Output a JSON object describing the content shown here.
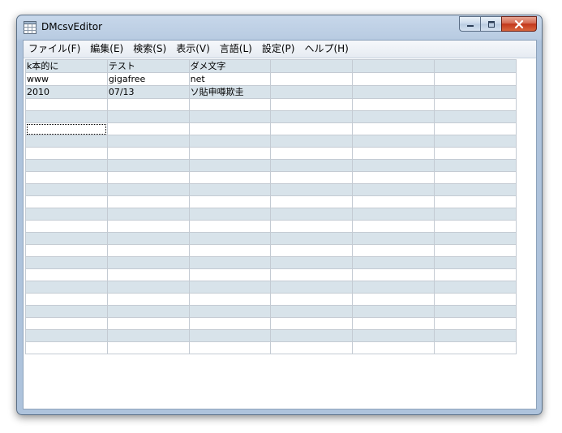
{
  "window": {
    "title": "DMcsvEditor"
  },
  "menu": [
    "ファイル(F)",
    "編集(E)",
    "検索(S)",
    "表示(V)",
    "言語(L)",
    "設定(P)",
    "ヘルプ(H)"
  ],
  "grid": {
    "columns": 6,
    "rows": [
      [
        "k本的に",
        "テスト",
        "ダメ文字",
        "",
        "",
        ""
      ],
      [
        "www",
        "gigafree",
        "net",
        "",
        "",
        ""
      ],
      [
        "2010",
        "07/13",
        "ソ貼申噂欺圭",
        "",
        "",
        ""
      ],
      [
        "",
        "",
        "",
        "",
        "",
        ""
      ],
      [
        "",
        "",
        "",
        "",
        "",
        ""
      ],
      [
        "",
        "",
        "",
        "",
        "",
        ""
      ],
      [
        "",
        "",
        "",
        "",
        "",
        ""
      ],
      [
        "",
        "",
        "",
        "",
        "",
        ""
      ],
      [
        "",
        "",
        "",
        "",
        "",
        ""
      ],
      [
        "",
        "",
        "",
        "",
        "",
        ""
      ],
      [
        "",
        "",
        "",
        "",
        "",
        ""
      ],
      [
        "",
        "",
        "",
        "",
        "",
        ""
      ],
      [
        "",
        "",
        "",
        "",
        "",
        ""
      ],
      [
        "",
        "",
        "",
        "",
        "",
        ""
      ],
      [
        "",
        "",
        "",
        "",
        "",
        ""
      ],
      [
        "",
        "",
        "",
        "",
        "",
        ""
      ],
      [
        "",
        "",
        "",
        "",
        "",
        ""
      ],
      [
        "",
        "",
        "",
        "",
        "",
        ""
      ],
      [
        "",
        "",
        "",
        "",
        "",
        ""
      ],
      [
        "",
        "",
        "",
        "",
        "",
        ""
      ],
      [
        "",
        "",
        "",
        "",
        "",
        ""
      ],
      [
        "",
        "",
        "",
        "",
        "",
        ""
      ],
      [
        "",
        "",
        "",
        "",
        "",
        ""
      ],
      [
        "",
        "",
        "",
        "",
        "",
        ""
      ]
    ],
    "selected_cell": [
      5,
      0
    ]
  },
  "icons": {
    "app": "spreadsheet-icon",
    "minimize": "minimize-icon",
    "maximize": "maximize-icon",
    "close": "close-icon"
  }
}
